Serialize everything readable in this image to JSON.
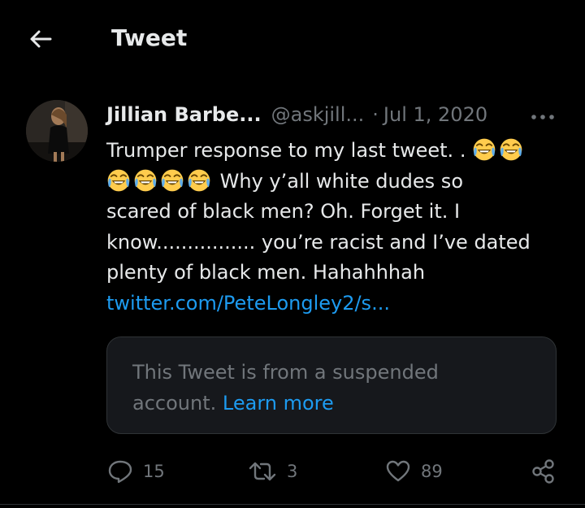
{
  "header": {
    "title": "Tweet",
    "back_icon": "arrow-left-icon"
  },
  "tweet": {
    "author_name": "Jillian Barbe...",
    "author_handle": "@askjill...",
    "separator": "·",
    "date": "Jul 1, 2020",
    "more_icon": "more-horizontal-icon",
    "text": {
      "line1": "Trumper response to my last tweet. .",
      "line2": "Why y’all white dudes so",
      "line3": "scared of black men? Oh. Forget it. I",
      "line4": "know................  you’re racist and I’ve dated",
      "line5": "plenty of black men. Hahahhhah"
    },
    "emoji_icon": "face-with-tears-of-joy-emoji",
    "link": "twitter.com/PeteLongley2/s..."
  },
  "quote": {
    "text": "This Tweet is from a suspended account.",
    "link_label": "Learn more"
  },
  "actions": {
    "reply": {
      "icon": "reply-icon",
      "count": "15"
    },
    "retweet": {
      "icon": "retweet-icon",
      "count": "3"
    },
    "like": {
      "icon": "heart-icon",
      "count": "89"
    },
    "share": {
      "icon": "share-icon"
    }
  },
  "colors": {
    "background": "#000000",
    "text_primary": "#e7e9ea",
    "text_secondary": "#71767b",
    "accent": "#1d9bf0",
    "border": "#2f3336"
  }
}
